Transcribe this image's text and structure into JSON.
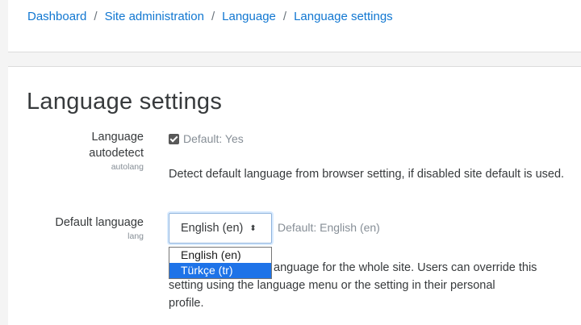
{
  "breadcrumb": {
    "items": [
      "Dashboard",
      "Site administration",
      "Language",
      "Language settings"
    ],
    "separator": "/"
  },
  "page": {
    "title": "Language settings"
  },
  "settings": {
    "autodetect": {
      "label_line1": "Language",
      "label_line2": "autodetect",
      "key": "autolang",
      "checked": true,
      "default_text": "Default: Yes",
      "description": "Detect default language from browser setting, if disabled site default is used."
    },
    "default_language": {
      "label": "Default language",
      "key": "lang",
      "selected_value": "English (en)",
      "default_text": "Default: English (en)",
      "options": [
        "English (en)",
        "Türkçe (tr)"
      ],
      "highlighted_option": "Türkçe (tr)",
      "description_visible_part1": "anguage for the whole site. Users can override this",
      "description_line2": "setting using the language menu or the setting in their personal",
      "description_line3": "profile."
    }
  },
  "colors": {
    "link": "#1177d1",
    "highlight": "#1e73e8",
    "muted": "#868e96"
  }
}
